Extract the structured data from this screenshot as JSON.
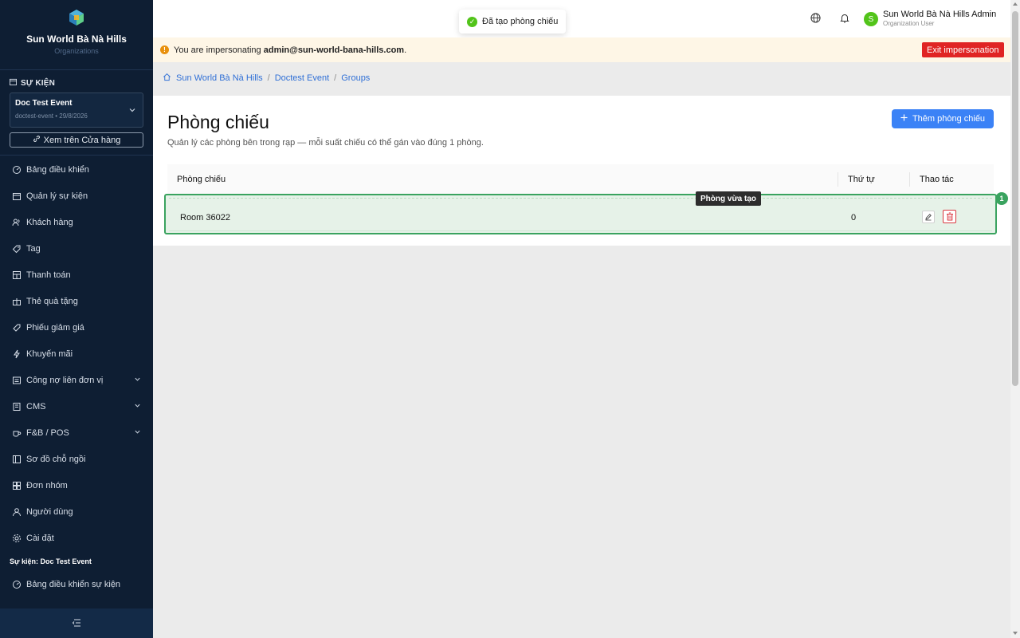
{
  "sidebar": {
    "org_name": "Sun World Bà Nà Hills",
    "org_sub": "Organizations",
    "section_label": "SỰ KIỆN",
    "event_name": "Doc Test Event",
    "event_meta": "doctest-event • 29/8/2026",
    "store_link": "Xem trên Cửa hàng",
    "items": [
      {
        "label": "Bảng điều khiển",
        "icon": "dashboard-icon"
      },
      {
        "label": "Quản lý sự kiện",
        "icon": "calendar-icon"
      },
      {
        "label": "Khách hàng",
        "icon": "users-icon"
      },
      {
        "label": "Tag",
        "icon": "tag-icon"
      },
      {
        "label": "Thanh toán",
        "icon": "payment-icon"
      },
      {
        "label": "Thẻ quà tặng",
        "icon": "gift-icon"
      },
      {
        "label": "Phiếu giảm giá",
        "icon": "coupon-icon"
      },
      {
        "label": "Khuyến mãi",
        "icon": "promo-icon"
      },
      {
        "label": "Công nợ liên đơn vị",
        "icon": "debt-icon",
        "has_submenu": true
      },
      {
        "label": "CMS",
        "icon": "cms-icon",
        "has_submenu": true
      },
      {
        "label": "F&B / POS",
        "icon": "coffee-icon",
        "has_submenu": true
      },
      {
        "label": "Sơ đồ chỗ ngồi",
        "icon": "seatmap-icon"
      },
      {
        "label": "Đơn nhóm",
        "icon": "group-order-icon"
      },
      {
        "label": "Người dùng",
        "icon": "user-icon"
      },
      {
        "label": "Cài đặt",
        "icon": "settings-icon"
      }
    ],
    "event_section_label": "Sự kiện: Doc Test Event",
    "event_items": [
      {
        "label": "Bảng điều khiển sự kiện",
        "icon": "dashboard-icon"
      }
    ]
  },
  "header": {
    "toast": "Đã tạo phòng chiếu",
    "user_initial": "S",
    "user_name": "Sun World Bà Nà Hills Admin",
    "user_role": "Organization User"
  },
  "banner": {
    "prefix": "You are impersonating ",
    "email": "admin@sun-world-bana-hills.com",
    "suffix": ".",
    "exit_label": "Exit impersonation"
  },
  "breadcrumb": [
    "Sun World Bà Nà Hills",
    "Doctest Event",
    "Groups"
  ],
  "page": {
    "title": "Phòng chiếu",
    "subtitle": "Quản lý các phòng bên trong rạp — mỗi suất chiếu có thể gán vào đúng 1 phòng.",
    "add_button": "Thêm phòng chiếu"
  },
  "table": {
    "columns": [
      "Phòng chiếu",
      "Thứ tự",
      "Thao tác"
    ],
    "rows": [
      {
        "name": "Room 36022",
        "order": "0"
      }
    ]
  },
  "annotation": {
    "tooltip": "Phòng vừa tạo",
    "badge": "1"
  },
  "colors": {
    "sidebar_bg": "#0e1e33",
    "primary": "#3b82f6",
    "danger": "#e02424",
    "success": "#3aa35f",
    "banner_bg": "#fef6e6"
  }
}
